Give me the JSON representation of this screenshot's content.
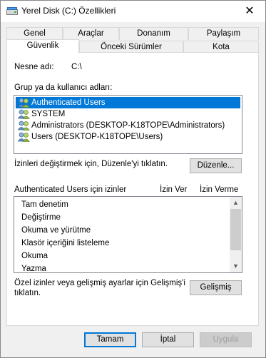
{
  "window": {
    "title": "Yerel Disk (C:) Özellikleri",
    "close_glyph": "✕"
  },
  "tabs_top": [
    "Genel",
    "Araçlar",
    "Donanım",
    "Paylaşım"
  ],
  "tabs_bottom": [
    "Güvenlik",
    "Önceki Sürümler",
    "Kota"
  ],
  "active_tab": "Güvenlik",
  "object": {
    "label": "Nesne adı:",
    "value": "C:\\"
  },
  "groups": {
    "label": "Grup ya da kullanıcı adları:",
    "items": [
      "Authenticated Users",
      "SYSTEM",
      "Administrators (DESKTOP-K18TOPE\\Administrators)",
      "Users (DESKTOP-K18TOPE\\Users)"
    ],
    "selected_index": 0
  },
  "edit": {
    "hint": "İzinleri değiştirmek için, Düzenle'yi tıklatın.",
    "button": "Düzenle..."
  },
  "permissions": {
    "header": "Authenticated Users için izinler",
    "allow_col": "İzin Ver",
    "deny_col": "İzin Verme",
    "items": [
      "Tam denetim",
      "Değiştirme",
      "Okuma ve yürütme",
      "Klasör içeriğini listeleme",
      "Okuma",
      "Yazma"
    ]
  },
  "advanced": {
    "hint_line1": "Özel izinler veya gelişmiş ayarlar için Gelişmiş'i",
    "hint_line2": "tıklatın.",
    "button": "Gelişmiş"
  },
  "footer": {
    "ok": "Tamam",
    "cancel": "İptal",
    "apply": "Uygula"
  },
  "colors": {
    "selection": "#0078d7",
    "default_button_border": "#0078d7"
  },
  "icons": {
    "drive": "drive-icon",
    "users": "users-icon"
  }
}
